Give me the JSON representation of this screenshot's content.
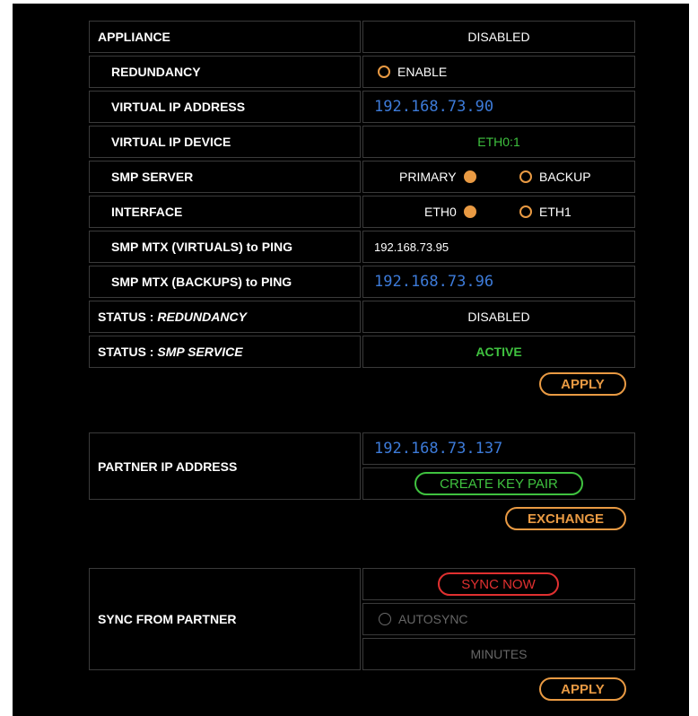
{
  "appliance": {
    "label": "APPLIANCE",
    "value": "DISABLED"
  },
  "redundancy": {
    "label": "REDUNDANCY",
    "option": "ENABLE"
  },
  "virtual_ip_address": {
    "label": "VIRTUAL IP ADDRESS",
    "value": "192.168.73.90"
  },
  "virtual_ip_device": {
    "label": "VIRTUAL IP DEVICE",
    "value": "ETH0:1"
  },
  "smp_server": {
    "label": "SMP SERVER",
    "primary": "PRIMARY",
    "backup": "BACKUP",
    "selected": "PRIMARY"
  },
  "interface": {
    "label": "INTERFACE",
    "eth0": "ETH0",
    "eth1": "ETH1",
    "selected": "ETH0"
  },
  "smp_mtx_virtuals": {
    "label": "SMP MTX (VIRTUALS) to PING",
    "value": "192.168.73.95"
  },
  "smp_mtx_backups": {
    "label": "SMP MTX (BACKUPS) to PING",
    "value": "192.168.73.96"
  },
  "status_redundancy": {
    "label_prefix": "STATUS : ",
    "label_italic": "REDUNDANCY",
    "value": "DISABLED"
  },
  "status_smp_service": {
    "label_prefix": "STATUS : ",
    "label_italic": "SMP SERVICE",
    "value": "ACTIVE"
  },
  "apply_label": "APPLY",
  "partner": {
    "label": "PARTNER IP ADDRESS",
    "ip": "192.168.73.137",
    "create_key_pair": "CREATE KEY PAIR",
    "exchange": "EXCHANGE"
  },
  "sync": {
    "label": "SYNC FROM PARTNER",
    "sync_now": "SYNC NOW",
    "autosync": "AUTOSYNC",
    "minutes": "MINUTES",
    "apply": "APPLY"
  },
  "colors": {
    "orange": "#e99a43",
    "green": "#3fc23f",
    "red": "#e03030",
    "blue_ip": "#3d7bd9",
    "disabled_gray": "#666666"
  }
}
